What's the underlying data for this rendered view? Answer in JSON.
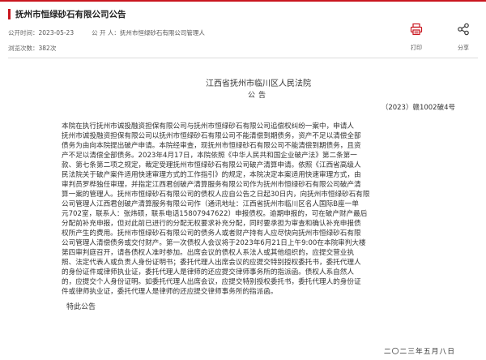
{
  "header": {
    "title": "抚州市恒绿砂石有限公司公告"
  },
  "meta": {
    "publish_label": "公开时间：",
    "publish_date": "2023-05-23",
    "publisher_label": "公 开 人：",
    "publisher": "抚州市恒绿砂石有限公司管理人",
    "views_label": "浏览次数：",
    "views": "382次"
  },
  "actions": {
    "print_label": "打印",
    "share_label": "分享",
    "print_icon": "print-icon",
    "share_icon": "share-icon"
  },
  "document": {
    "court": "江西省抚州市临川区人民法院",
    "notice_title": "公告",
    "case_number": "（2023）赣1002破4号",
    "body_lines": [
      "    本院在执行抚州市诚投融资担保有限公司与抚州市恒绿砂石有限公司追偿权纠纷一案中，申请人",
      "抚州市诚投融资担保有限公司以抚州市恒绿砂石有限公司不能清偿到期债务，资产不足以清偿全部",
      "债务为由向本院提出破产申请。本院经审查，现抚州市恒绿砂石有限公司不能清偿到期债务，且资",
      "产不足以清偿全部债务。2023年4月17日，本院依照《中华人民共和国企业破产法》第二条第一",
      "款、第七条第二项之规定，裁定受理抚州市恒绿砂石有限公司破产清算申请。依照《江西省高级人",
      "民法院关于破产案件适用快速审理方式的工作指引》的规定，本院决定本案适用快速审理方式，由",
      "审判员罗桦独任审理，并指定江西君创破产清算服务有限公司作为抚州市恒绿砂石有限公司破产清",
      "算一案的管理人。抚州市恒绿砂石有限公司的债权人应自公告之日起30日内，向抚州市恒绿砂石有限",
      "公司管理人江西君创破产清算服务有限公司作（通讯地址：江西省抚州市临川区名人国际B座一单",
      "元702室，联系人：张炜硕，联系电话15807947622）申报债权。逾期申报的，可在破产财产最后",
      "分配前补充申报，但对此前已进行的分配无权要求补充分配，同时要承担为审查和确认补充申报债",
      "权所产生的费用。抚州市恒绿砂石有限公司的债务人或者财产持有人应尽快向抚州市恒绿砂石有限",
      "公司管理人清偿债务或交付财产。第一次债权人会议将于2023年6月21日上午9:00在本院审判大楼",
      "第四审判庭召开，请各债权人准时参加。出席会议的债权人系法人或其他组织的，应提交营业执",
      "照、法定代表人或负责人身份证明书；委托代理人出席会议的应提交特别授权委托书，委托代理人",
      "的身份证件或律师执业证，委托代理人是律师的还应提交律师事务所的指派函。债权人系自然人",
      "的，应提交个人身份证明。如委托代理人出席会议，应提交特别授权委托书，委托代理人的身份证",
      "件或律师执业证，委托代理人是律师的还应提交律师事务所的指派函。"
    ],
    "closing": "特此公告",
    "date": "二〇二三年五月八日"
  },
  "colors": {
    "accent": "#c9151e",
    "text": "#333333",
    "meta_text": "#666666",
    "divider": "#dcdcdc"
  }
}
